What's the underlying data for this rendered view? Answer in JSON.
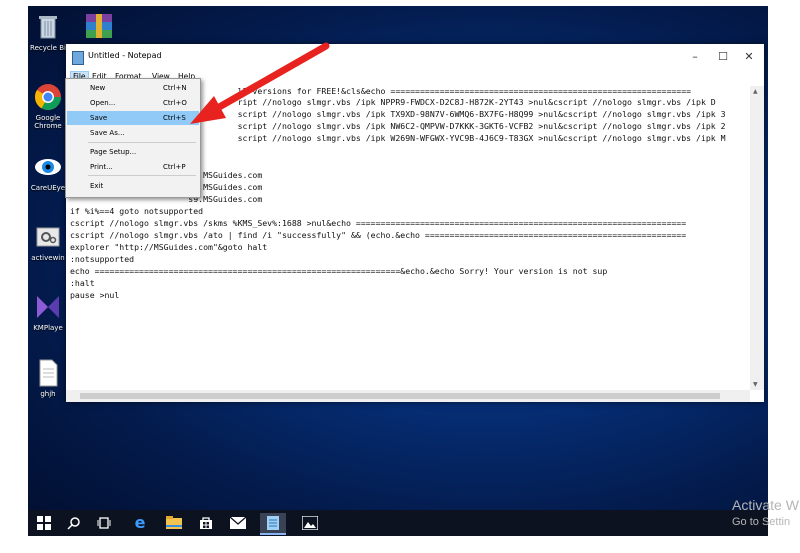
{
  "desktop": {
    "icons": [
      {
        "label": "Recycle Bi"
      },
      {
        "label": "Google Chrome"
      },
      {
        "label": "CareUEye"
      },
      {
        "label": "activewin"
      },
      {
        "label": "KMPlaye"
      },
      {
        "label": "ghjh"
      }
    ]
  },
  "notepad": {
    "title": "Untitled - Notepad",
    "menu": [
      "File",
      "Edit",
      "Format",
      "View",
      "Help"
    ],
    "lines": [
      "                                  ll versions for FREE!&cls&echo =============================================================",
      "                                  ript //nologo slmgr.vbs /ipk NPPR9-FWDCX-D2C8J-H872K-2YT43 >nul&cscript //nologo slmgr.vbs /ipk D",
      "                                  script //nologo slmgr.vbs /ipk TX9XD-98N7V-6WMQ6-BX7FG-H8Q99 >nul&cscript //nologo slmgr.vbs /ipk 3",
      "                                  script //nologo slmgr.vbs /ipk NW6C2-QMPVW-D7KKK-3GKT6-VCFB2 >nul&cscript //nologo slmgr.vbs /ipk 2",
      "                                  script //nologo slmgr.vbs /ipk W269N-WFGWX-YVC9B-4J6C9-T83GX >nul&cscript //nologo slmgr.vbs /ipk M",
      "",
      "                        s7.MSGuides.com",
      "                        s8.MSGuides.com",
      "                        s9.MSGuides.com",
      "if %i%==4 goto notsupported",
      "cscript //nologo slmgr.vbs /skms %KMS_Sev%:1688 >nul&echo ===================================================================",
      "cscript //nologo slmgr.vbs /ato | find /i \"successfully\" && (echo.&echo =====================================================",
      "explorer \"http://MSGuides.com\"&goto halt",
      ":notsupported",
      "echo ==============================================================&echo.&echo Sorry! Your version is not sup",
      ":halt",
      "pause >nul"
    ]
  },
  "file_menu": {
    "items": [
      {
        "label": "New",
        "shortcut": "Ctrl+N"
      },
      {
        "label": "Open...",
        "shortcut": "Ctrl+O"
      },
      {
        "label": "Save",
        "shortcut": "Ctrl+S"
      },
      {
        "label": "Save As...",
        "shortcut": ""
      },
      {
        "label": "Page Setup...",
        "shortcut": ""
      },
      {
        "label": "Print...",
        "shortcut": "Ctrl+P"
      },
      {
        "label": "Exit",
        "shortcut": ""
      }
    ],
    "highlighted": "Save"
  },
  "watermark": {
    "line1": "Activate W",
    "line2": "Go to Settin"
  },
  "colors": {
    "arrow": "#e8231f",
    "highlight": "#91c9f7",
    "taskbar": "#0d1220"
  },
  "taskbar_icons": [
    "windows-start-icon",
    "search-icon",
    "task-view-icon",
    "edge-icon",
    "file-explorer-icon",
    "store-icon",
    "mail-icon",
    "notepad-icon",
    "photos-icon"
  ]
}
